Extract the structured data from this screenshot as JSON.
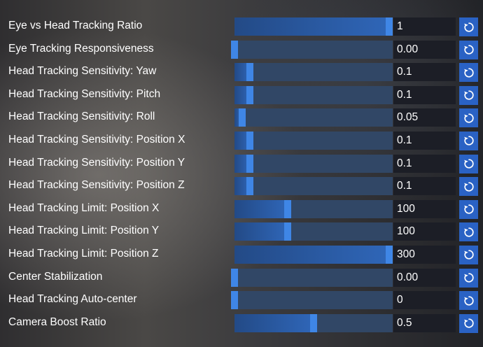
{
  "settings": [
    {
      "label": "Eye vs Head Tracking Ratio",
      "value": "1",
      "slider_fraction": 1.0
    },
    {
      "label": "Eye Tracking Responsiveness",
      "value": "0.00",
      "slider_fraction": 0.0
    },
    {
      "label": "Head Tracking Sensitivity: Yaw",
      "value": "0.1",
      "slider_fraction": 0.08
    },
    {
      "label": "Head Tracking Sensitivity: Pitch",
      "value": "0.1",
      "slider_fraction": 0.08
    },
    {
      "label": "Head Tracking Sensitivity: Roll",
      "value": "0.05",
      "slider_fraction": 0.03
    },
    {
      "label": "Head Tracking Sensitivity: Position X",
      "value": "0.1",
      "slider_fraction": 0.08
    },
    {
      "label": "Head Tracking Sensitivity: Position Y",
      "value": "0.1",
      "slider_fraction": 0.08
    },
    {
      "label": "Head Tracking Sensitivity: Position Z",
      "value": "0.1",
      "slider_fraction": 0.08
    },
    {
      "label": "Head Tracking Limit: Position X",
      "value": "100",
      "slider_fraction": 0.33
    },
    {
      "label": "Head Tracking Limit: Position Y",
      "value": "100",
      "slider_fraction": 0.33
    },
    {
      "label": "Head Tracking Limit: Position Z",
      "value": "300",
      "slider_fraction": 1.0
    },
    {
      "label": "Center Stabilization",
      "value": "0.00",
      "slider_fraction": 0.0
    },
    {
      "label": "Head Tracking Auto-center",
      "value": "0",
      "slider_fraction": 0.0
    },
    {
      "label": "Camera Boost Ratio",
      "value": "0.5",
      "slider_fraction": 0.5
    }
  ],
  "reset_icon": "reset-rotate-icon",
  "colors": {
    "slider_track": "#314766",
    "slider_thumb": "#3f86e6",
    "reset_button": "#2a62c4",
    "value_box": "#1c1e26"
  }
}
